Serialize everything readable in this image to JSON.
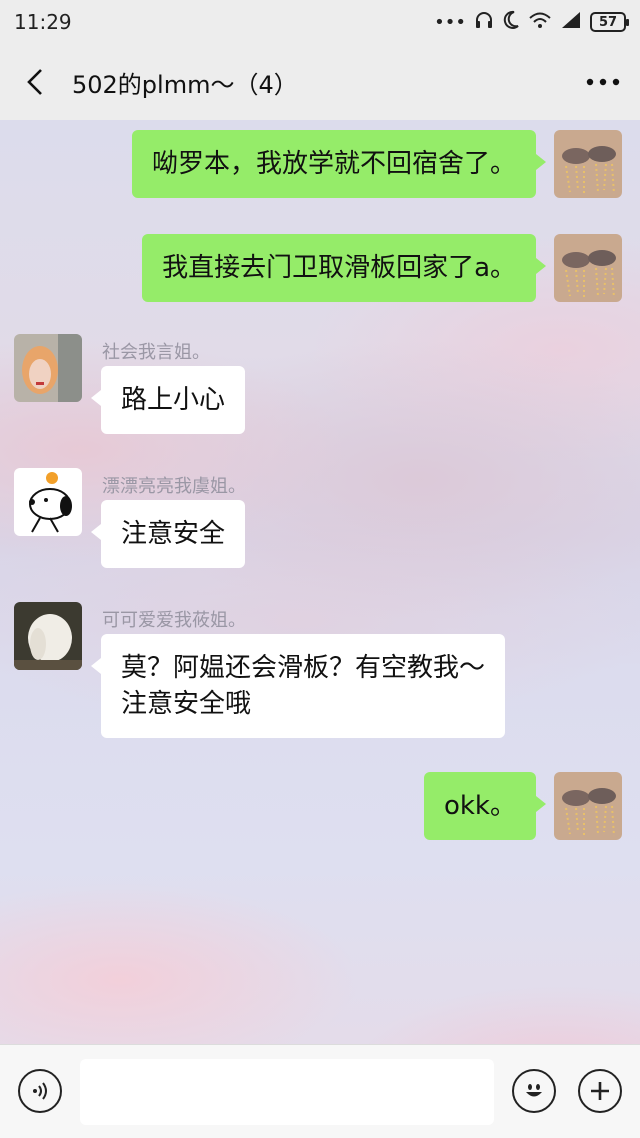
{
  "status": {
    "time": "11:29",
    "icons": [
      "dots-icon",
      "headphone-icon",
      "moon-icon",
      "wifi-icon",
      "signal-icon"
    ],
    "battery": "57"
  },
  "header": {
    "title": "502的plmm～（4）",
    "back_icon": "chevron-left-icon",
    "more_icon": "more-dots-icon"
  },
  "chat": {
    "messages": [
      {
        "side": "out",
        "text": "呦罗本，我放学就不回宿舍了。"
      },
      {
        "side": "out",
        "text": "我直接去门卫取滑板回家了a。"
      },
      {
        "side": "in",
        "sender": "社会我言姐。",
        "text": "路上小心"
      },
      {
        "side": "in",
        "sender": "漂漂亮亮我虞姐。",
        "text": "注意安全"
      },
      {
        "side": "in",
        "sender": "可可爱爱我莜姐。",
        "text_line1": "莫？阿媪还会滑板？有空教我～",
        "text_line2": "注意安全哦"
      },
      {
        "side": "out",
        "text": "okk。"
      }
    ]
  },
  "input_bar": {
    "voice_icon": "voice-icon",
    "emoji_icon": "emoji-icon",
    "plus_icon": "plus-icon",
    "value": "",
    "placeholder": ""
  },
  "colors": {
    "outgoing_bubble": "#95ec69",
    "incoming_bubble": "#ffffff",
    "bar_background": "#ededed",
    "sender_name": "#9a97a5"
  }
}
